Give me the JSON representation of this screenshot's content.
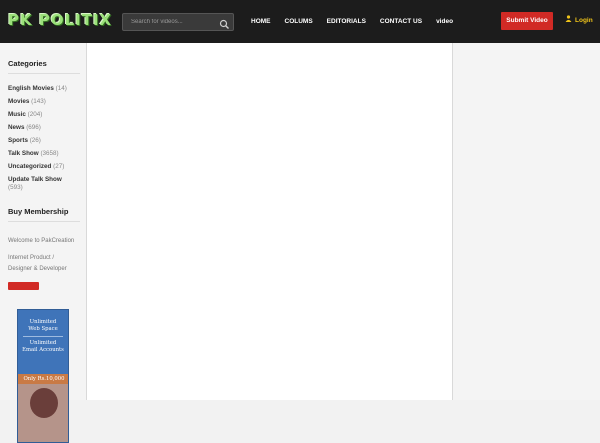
{
  "header": {
    "logo_text": "PK POLITIX",
    "search": {
      "placeholder": "Search for videos..."
    },
    "nav": [
      "HOME",
      "COLUMS",
      "EDITORIALS",
      "CONTACT US",
      "video"
    ],
    "submit_label": "Submit Video",
    "login_label": "Login"
  },
  "sidebar": {
    "categories_title": "Categories",
    "categories": [
      {
        "name": "English Movies",
        "count": "(14)"
      },
      {
        "name": "Movies",
        "count": "(143)"
      },
      {
        "name": "Music",
        "count": "(204)"
      },
      {
        "name": "News",
        "count": "(696)"
      },
      {
        "name": "Sports",
        "count": "(26)"
      },
      {
        "name": "Talk Show",
        "count": "(3658)"
      },
      {
        "name": "Uncategorized",
        "count": "(27)"
      },
      {
        "name": "Update Talk Show",
        "count": "(593)"
      }
    ],
    "membership_title": "Buy Membership",
    "welcome_text": "Welcome to PakCreation",
    "tagline_1": "Internet Product /",
    "tagline_2": "Designer & Developer"
  },
  "ad": {
    "line1": "Unlimited",
    "line2": "Web Space",
    "line3": "Unlimited",
    "line4": "Email Accounts",
    "price": "Only Rs.10,000"
  },
  "colors": {
    "topbar": "#1c1c1c",
    "accent_red": "#d12a25",
    "login_yellow": "#f0c419",
    "logo_green": "#9be07a"
  }
}
